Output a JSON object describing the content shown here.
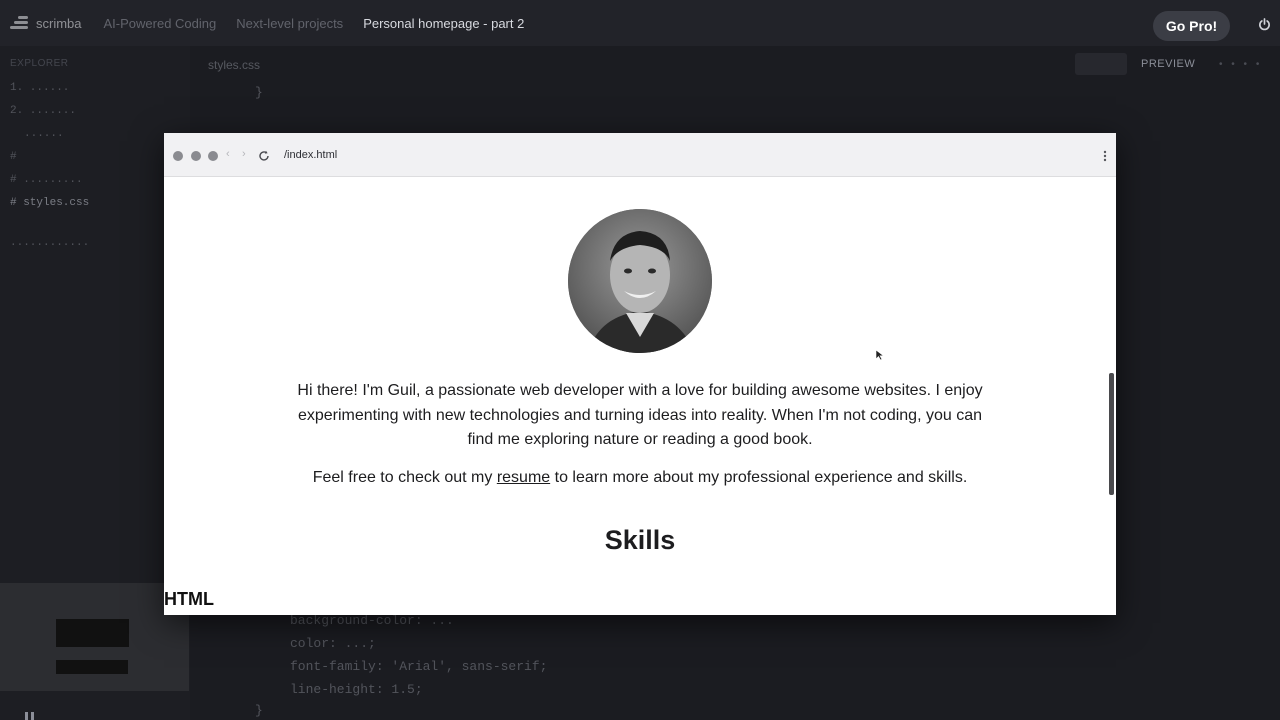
{
  "app": {
    "brand": "scrimba",
    "breadcrumbs": [
      "AI-Powered Coding",
      "Next-level projects"
    ],
    "current_page": "Personal homepage - part 2",
    "gopro_label": "Go Pro!"
  },
  "sidebar": {
    "title": "EXPLORER",
    "files": [
      "1. ......",
      "2. .......",
      "......",
      "#",
      "# .........",
      "# styles.css",
      "............"
    ]
  },
  "editor": {
    "active_tab": "styles.css",
    "preview_label": "PREVIEW",
    "code_lines": [
      "}",
      "background-color: ...",
      "color: ...;",
      "font-family: 'Arial', sans-serif;",
      "line-height: 1.5;",
      "}"
    ]
  },
  "preview": {
    "url": "/index.html",
    "intro": "Hi there! I'm Guil, a passionate web developer with a love for building awesome websites. I enjoy experimenting with new technologies and turning ideas into reality. When I'm not coding, you can find me exploring nature or reading a good book.",
    "resume_before": "Feel free to check out my",
    "resume_link": "resume",
    "resume_after": "to learn more about my professional experience and skills.",
    "skills_heading": "Skills",
    "html_heading": "HTML"
  },
  "colors": {
    "background": "#1b1c21",
    "topbar": "#222329",
    "gopro_bg": "#3b3d45",
    "preview_bg": "#ffffff",
    "text_dark": "#1d1d1f"
  },
  "icons": [
    "scrimba-logo-icon",
    "power-icon",
    "reload-icon",
    "kebab-menu-icon",
    "mouse-cursor-icon"
  ]
}
